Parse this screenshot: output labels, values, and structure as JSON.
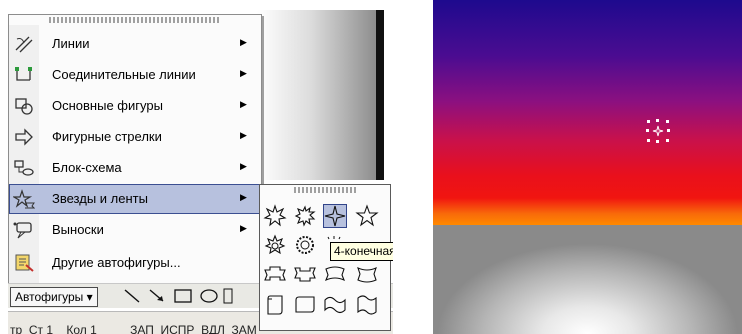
{
  "menu": {
    "items": [
      {
        "label": "Линии",
        "icon": "lines-icon"
      },
      {
        "label": "Соединительные линии",
        "icon": "connectors-icon"
      },
      {
        "label": "Основные фигуры",
        "icon": "basic-shapes-icon"
      },
      {
        "label": "Фигурные стрелки",
        "icon": "block-arrows-icon"
      },
      {
        "label": "Блок-схема",
        "icon": "flowchart-icon"
      },
      {
        "label": "Звезды и ленты",
        "icon": "stars-banners-icon"
      },
      {
        "label": "Выноски",
        "icon": "callouts-icon"
      },
      {
        "label": "Другие автофигуры...",
        "icon": "more-autoshapes-icon"
      }
    ],
    "active_item": "Звезды и ленты"
  },
  "submenu": {
    "tooltip": "4-конечная",
    "selected_symbol": "star-4-point"
  },
  "toolbar": {
    "autoshapes_label": "Автофигуры ▾"
  },
  "statusbar": {
    "text": "тр  Ст 1    Кол 1          ЗАП  ИСПР  ВДЛ  ЗАМ"
  },
  "colors": {
    "highlight": "#b7c1de",
    "gradient_top": "#1e0a8e",
    "gradient_red": "#e9101c",
    "gradient_orange": "#ff8a00"
  }
}
